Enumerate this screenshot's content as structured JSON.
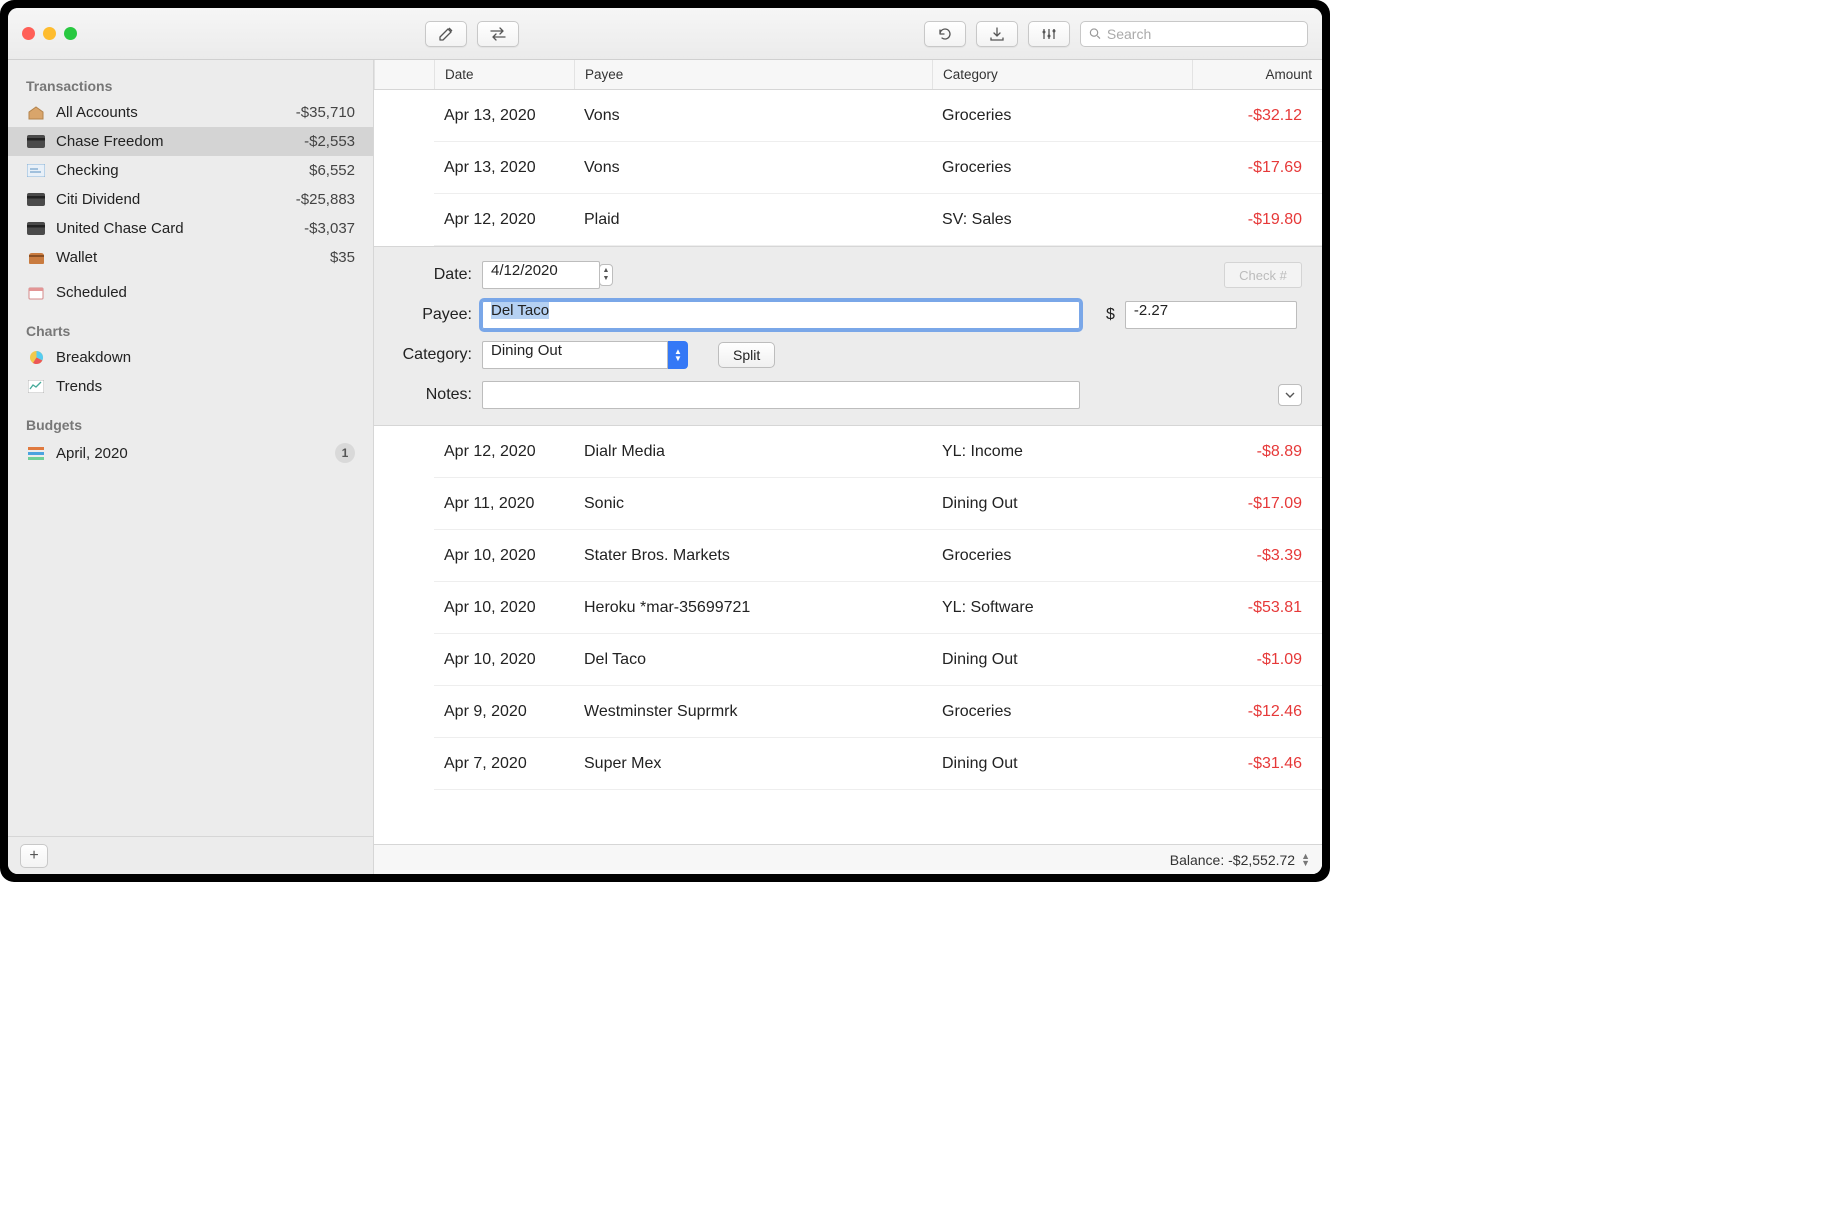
{
  "search_placeholder": "Search",
  "sb": {
    "transactions_head": "Transactions",
    "charts_head": "Charts",
    "budgets_head": "Budgets",
    "accounts": [
      {
        "label": "All Accounts",
        "val": "-$35,710"
      },
      {
        "label": "Chase Freedom",
        "val": "-$2,553"
      },
      {
        "label": "Checking",
        "val": "$6,552"
      },
      {
        "label": "Citi Dividend",
        "val": "-$25,883"
      },
      {
        "label": "United Chase Card",
        "val": "-$3,037"
      },
      {
        "label": "Wallet",
        "val": "$35"
      }
    ],
    "scheduled": "Scheduled",
    "breakdown": "Breakdown",
    "trends": "Trends",
    "budget": {
      "label": "April, 2020",
      "badge": "1"
    }
  },
  "cols": {
    "date": "Date",
    "payee": "Payee",
    "category": "Category",
    "amount": "Amount"
  },
  "rows_top": [
    {
      "d": "Apr 13, 2020",
      "p": "Vons",
      "c": "Groceries",
      "a": "-$32.12"
    },
    {
      "d": "Apr 13, 2020",
      "p": "Vons",
      "c": "Groceries",
      "a": "-$17.69"
    },
    {
      "d": "Apr 12, 2020",
      "p": "Plaid",
      "c": "SV: Sales",
      "a": "-$19.80"
    }
  ],
  "rows_bot": [
    {
      "d": "Apr 12, 2020",
      "p": "Dialr Media",
      "c": "YL: Income",
      "a": "-$8.89"
    },
    {
      "d": "Apr 11, 2020",
      "p": "Sonic",
      "c": "Dining Out",
      "a": "-$17.09"
    },
    {
      "d": "Apr 10, 2020",
      "p": "Stater Bros. Markets",
      "c": "Groceries",
      "a": "-$3.39"
    },
    {
      "d": "Apr 10, 2020",
      "p": "Heroku *mar-35699721",
      "c": "YL: Software",
      "a": "-$53.81"
    },
    {
      "d": "Apr 10, 2020",
      "p": "Del Taco",
      "c": "Dining Out",
      "a": "-$1.09"
    },
    {
      "d": "Apr 9, 2020",
      "p": "Westminster Suprmrk",
      "c": "Groceries",
      "a": "-$12.46"
    },
    {
      "d": "Apr 7, 2020",
      "p": "Super Mex",
      "c": "Dining Out",
      "a": "-$31.46"
    }
  ],
  "ed": {
    "date_lbl": "Date:",
    "date": "4/12/2020",
    "payee_lbl": "Payee:",
    "payee": "Del Taco",
    "dollar": "$",
    "amount": "-2.27",
    "cat_lbl": "Category:",
    "cat": "Dining Out",
    "split": "Split",
    "notes_lbl": "Notes:",
    "check_ph": "Check #"
  },
  "status": {
    "label": "Balance: -$2,552.72"
  }
}
